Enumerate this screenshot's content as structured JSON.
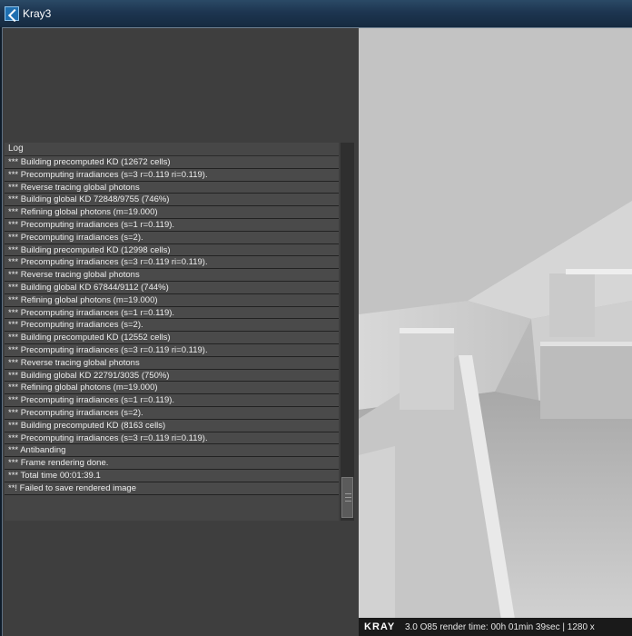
{
  "window": {
    "title": "Kray3"
  },
  "log": {
    "header": "Log",
    "lines": [
      "*** Building precomputed KD (12672 cells)",
      "*** Precomputing irradiances (s=3 r=0.119 ri=0.119).",
      "*** Reverse tracing global photons",
      "*** Building global KD 72848/9755 (746%)",
      "*** Refining global photons  (m=19.000)",
      "*** Precomputing irradiances (s=1 r=0.119).",
      "*** Precomputing irradiances (s=2).",
      "*** Building precomputed KD (12998 cells)",
      "*** Precomputing irradiances (s=3 r=0.119 ri=0.119).",
      "*** Reverse tracing global photons",
      "*** Building global KD 67844/9112 (744%)",
      "*** Refining global photons  (m=19.000)",
      "*** Precomputing irradiances (s=1 r=0.119).",
      "*** Precomputing irradiances (s=2).",
      "*** Building precomputed KD (12552 cells)",
      "*** Precomputing irradiances (s=3 r=0.119 ri=0.119).",
      "*** Reverse tracing global photons",
      "*** Building global KD 22791/3035 (750%)",
      "*** Refining global photons  (m=19.000)",
      "*** Precomputing irradiances (s=1 r=0.119).",
      "*** Precomputing irradiances (s=2).",
      "*** Building precomputed KD (8163 cells)",
      "*** Precomputing irradiances (s=3 r=0.119 ri=0.119).",
      "*** Antibanding",
      "*** Frame rendering done.",
      "*** Total time 00:01:39.1",
      "**! Failed to save rendered image"
    ]
  },
  "status": {
    "logo": "KRAY",
    "text": "3.0 O85 render time: 00h 01min 39sec | 1280 x"
  },
  "colors": {
    "titlebar": "#1d3550",
    "panel_bg": "#3e3e3e",
    "log_row": "#4a4a4a"
  }
}
